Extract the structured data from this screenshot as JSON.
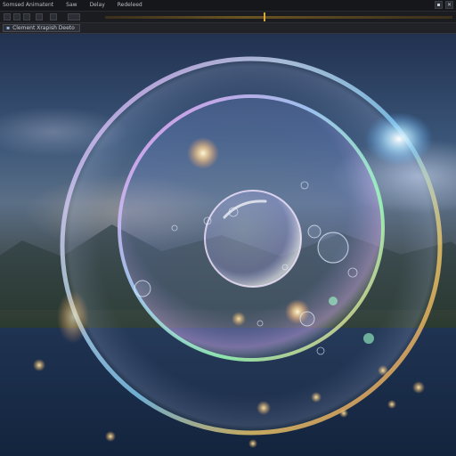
{
  "menubar": {
    "items": [
      "Somsed Animatent",
      "Saw",
      "Delay",
      "Redeleed"
    ]
  },
  "window_controls": {
    "minimize_icon": "minimize-icon",
    "close_icon": "close-icon"
  },
  "tab": {
    "label": "Clement Xrapish Deeto"
  },
  "colors": {
    "timeline_accent": "#d8a73a",
    "menubar_bg": "#15171b"
  }
}
